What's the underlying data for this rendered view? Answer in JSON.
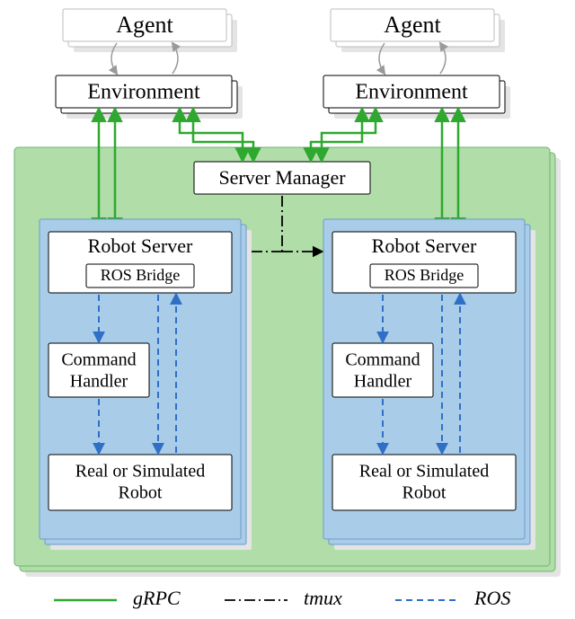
{
  "agent_left": "Agent",
  "agent_right": "Agent",
  "env_left": "Environment",
  "env_right": "Environment",
  "server_manager": "Server Manager",
  "robot_server_left": "Robot Server",
  "robot_server_right": "Robot Server",
  "ros_bridge_left": "ROS Bridge",
  "ros_bridge_right": "ROS Bridge",
  "cmd_handler_left_1": "Command",
  "cmd_handler_left_2": "Handler",
  "cmd_handler_right_1": "Command",
  "cmd_handler_right_2": "Handler",
  "robot_left_1": "Real or Simulated",
  "robot_left_2": "Robot",
  "robot_right_1": "Real or Simulated",
  "robot_right_2": "Robot",
  "legend_grpc": "gRPC",
  "legend_tmux": "tmux",
  "legend_ros": "ROS",
  "colors": {
    "green_line": "#2fa82f",
    "black_line": "#000000",
    "blue_line": "#2f6fc6",
    "green_fill": "#b0dda8",
    "blue_fill": "#a9cde9",
    "grey_text": "#9a9a9a",
    "grey_stroke": "#bdbdbd",
    "shadow": "#e4e4e4"
  }
}
